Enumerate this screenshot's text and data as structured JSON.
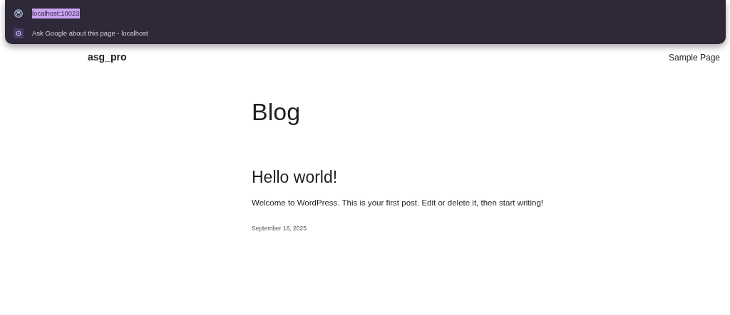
{
  "address_dropdown": {
    "suggestions": [
      {
        "kind": "site",
        "text": "localhost:10023",
        "text_selected": true
      },
      {
        "kind": "ask",
        "text": "Ask Google about this page - localhost",
        "text_selected": false
      }
    ]
  },
  "header": {
    "site_title": "asg_pro",
    "nav": [
      "Sample Page"
    ]
  },
  "page_title": "Blog",
  "posts": [
    {
      "title": "Hello world!",
      "excerpt": "Welcome to WordPress. This is your first post. Edit or delete it, then start writing!",
      "date": "September 16, 2025"
    }
  ]
}
